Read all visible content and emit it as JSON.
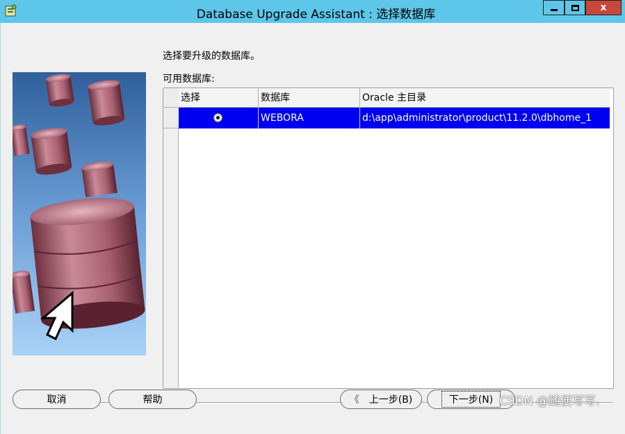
{
  "window": {
    "title": "Database Upgrade Assistant : 选择数据库",
    "min_icon": "minimize-icon",
    "max_icon": "maximize-icon",
    "close_label": "x"
  },
  "content": {
    "intro": "选择要升级的数据库。",
    "available_label": "可用数据库:"
  },
  "table": {
    "columns": [
      "选择",
      "数据库",
      "Oracle 主目录"
    ],
    "rows": [
      {
        "selected": true,
        "database": "WEBORA",
        "oracle_home": "d:\\app\\administrator\\product\\11.2.0\\dbhome_1"
      }
    ]
  },
  "buttons": {
    "cancel": "取消",
    "help": "帮助",
    "back": "上一步(B)",
    "next": "下一步(N)"
  },
  "watermark": "CSDN @随便写写.",
  "colors": {
    "titlebar": "#5dc6e9",
    "selection": "#0000f0",
    "close": "#c9463d"
  }
}
